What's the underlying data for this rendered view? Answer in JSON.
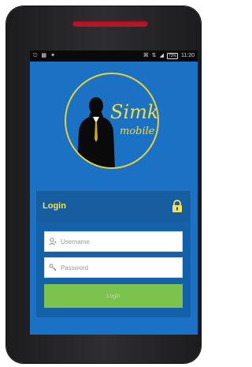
{
  "status_bar": {
    "left_icons": [
      "usb-icon",
      "notification-icon",
      "android-icon"
    ],
    "right_icons": [
      "wifi-icon",
      "signal-icon",
      "battery-icon"
    ],
    "battery": "73%",
    "time": "11:20"
  },
  "logo": {
    "line1": "Simka",
    "line2": "mobile",
    "accent_color": "#e8cf3c"
  },
  "login": {
    "title": "Login",
    "username_placeholder": "Username",
    "password_placeholder": "Password",
    "button_label": "Login"
  },
  "colors": {
    "screen_bg": "#1b72c4",
    "panel_bg": "#1461a9",
    "title": "#f1e35a",
    "button": "#7cc24f"
  }
}
